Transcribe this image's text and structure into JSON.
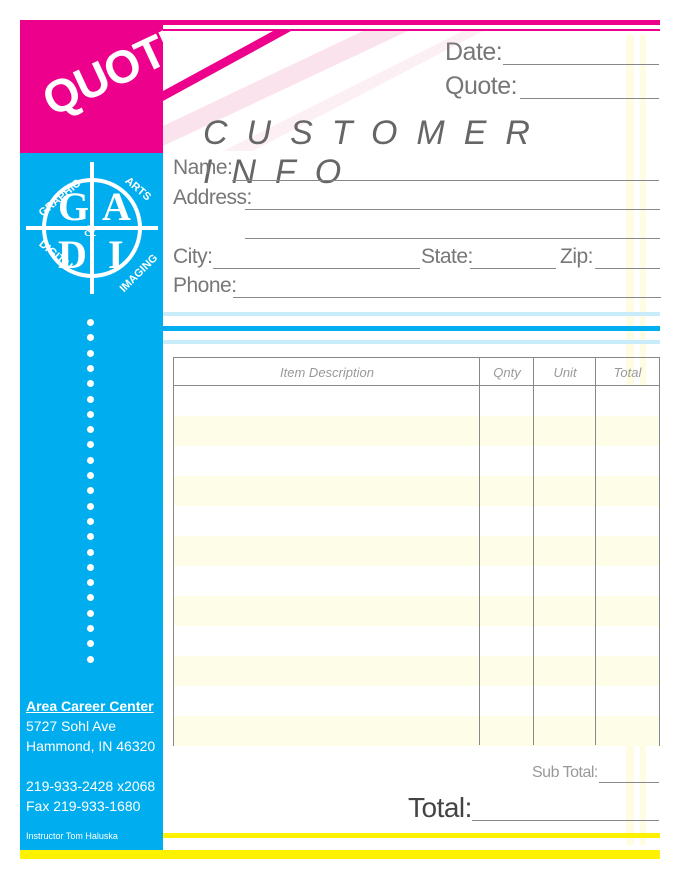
{
  "header": {
    "badge": "QUOTE",
    "date_label": "Date:",
    "quote_label": "Quote:"
  },
  "logo": {
    "letters": "GADI",
    "text": "Graphic Arts & Digital Imaging"
  },
  "customer": {
    "title": "CUSTOMER INFO",
    "name_label": "Name:",
    "address_label": "Address:",
    "city_label": "City:",
    "state_label": "State:",
    "zip_label": "Zip:",
    "phone_label": "Phone:"
  },
  "table": {
    "columns": [
      "Item Description",
      "Qnty",
      "Unit",
      "Total"
    ],
    "row_count": 12
  },
  "totals": {
    "subtotal_label": "Sub Total:",
    "total_label": "Total:"
  },
  "contact": {
    "org": "Area Career Center",
    "address1": "5727 Sohl Ave",
    "address2": "Hammond, IN 46320",
    "phone": "219-933-2428 x2068",
    "fax": "Fax 219-933-1680",
    "instructor": "Instructor Tom Haluska"
  },
  "colors": {
    "magenta": "#ec008c",
    "cyan": "#00aeef",
    "yellow": "#fff200"
  }
}
